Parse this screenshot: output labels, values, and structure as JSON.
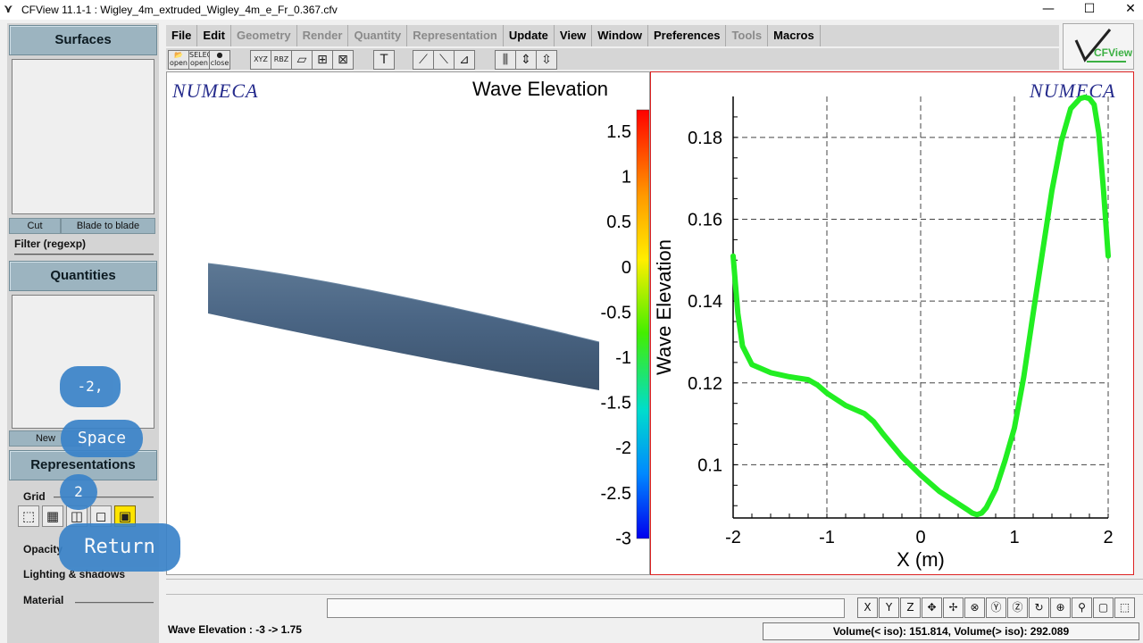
{
  "window": {
    "title": "CFView 11.1-1 : Wigley_4m_extruded_Wigley_4m_e_Fr_0.367.cfv",
    "icon": "cfview-app-icon",
    "controls": {
      "minimize": "—",
      "maximize": "☐",
      "close": "✕"
    }
  },
  "left_panel": {
    "surfaces": {
      "header": "Surfaces",
      "cut_label": "Cut",
      "blade_label": "Blade to blade",
      "filter_label": "Filter (regexp)"
    },
    "quantities": {
      "header": "Quantities",
      "new_label": "New"
    },
    "representations": {
      "header": "Representations",
      "grid_label": "Grid",
      "grid_icons": [
        "cube-icon",
        "grid-cube-icon",
        "solid-cube-icon",
        "edge-cube-icon",
        "selected-cube-icon"
      ],
      "opacity_label": "Opacity",
      "lighting_label": "Lighting & shadows",
      "material_label": "Material"
    }
  },
  "menubar": {
    "items": [
      {
        "label": "File",
        "enabled": true
      },
      {
        "label": "Edit",
        "enabled": true
      },
      {
        "label": "Geometry",
        "enabled": false
      },
      {
        "label": "Render",
        "enabled": false
      },
      {
        "label": "Quantity",
        "enabled": false
      },
      {
        "label": "Representation",
        "enabled": false
      },
      {
        "label": "Update",
        "enabled": true
      },
      {
        "label": "View",
        "enabled": true
      },
      {
        "label": "Window",
        "enabled": true
      },
      {
        "label": "Preferences",
        "enabled": true
      },
      {
        "label": "Tools",
        "enabled": false
      },
      {
        "label": "Macros",
        "enabled": true
      }
    ],
    "logo_text": "CFView"
  },
  "toolbar": {
    "open": "open",
    "select_open": "SELECT open",
    "close": "close",
    "xyz": "XYZ",
    "rbz": "RBZ"
  },
  "left_view": {
    "brand": "NUMECA",
    "title": "Wave Elevation",
    "colorbar_ticks": [
      "1.5",
      "1",
      "0.5",
      "0",
      "-0.5",
      "-1",
      "-1.5",
      "-2",
      "-2.5",
      "-3"
    ]
  },
  "right_view": {
    "brand": "NUMECA"
  },
  "chart_data": {
    "type": "line",
    "xlabel": "X (m)",
    "ylabel": "Wave Elevation",
    "xlim": [
      -2,
      2
    ],
    "ylim": [
      0.087,
      0.19
    ],
    "x_ticks": [
      "-2",
      "-1",
      "0",
      "1",
      "2"
    ],
    "y_ticks": [
      "0.1",
      "0.12",
      "0.14",
      "0.16",
      "0.18"
    ],
    "grid": true,
    "series": [
      {
        "color": "#22ee22",
        "x": [
          -2.0,
          -1.95,
          -1.9,
          -1.8,
          -1.6,
          -1.4,
          -1.2,
          -1.1,
          -1.0,
          -0.8,
          -0.6,
          -0.5,
          -0.4,
          -0.2,
          0.0,
          0.2,
          0.4,
          0.5,
          0.55,
          0.6,
          0.65,
          0.7,
          0.8,
          0.9,
          1.0,
          1.1,
          1.2,
          1.3,
          1.4,
          1.5,
          1.6,
          1.7,
          1.75,
          1.8,
          1.85,
          1.9,
          1.95,
          2.0
        ],
        "y": [
          0.151,
          0.137,
          0.129,
          0.1245,
          0.1225,
          0.1215,
          0.1208,
          0.1195,
          0.1175,
          0.1145,
          0.1125,
          0.1105,
          0.1075,
          0.102,
          0.0975,
          0.0935,
          0.0905,
          0.089,
          0.0882,
          0.0878,
          0.0882,
          0.0895,
          0.094,
          0.101,
          0.109,
          0.1215,
          0.137,
          0.152,
          0.167,
          0.179,
          0.187,
          0.1895,
          0.1898,
          0.1895,
          0.188,
          0.181,
          0.167,
          0.151
        ]
      }
    ]
  },
  "bottom": {
    "nav_buttons": [
      "X",
      "Y",
      "Z",
      "move-icon",
      "pan-icon",
      "rotate-x-icon",
      "rotate-y-icon",
      "rotate-z-icon",
      "rotate-icon",
      "zoom-in-icon",
      "zoom-icon",
      "fit-icon",
      "cube-view-icon"
    ],
    "status_left": "Wave Elevation :  -3  ->  1.75",
    "status_right": "Volume(< iso): 151.814, Volume(> iso): 292.089"
  },
  "key_overlays": [
    "-2,",
    "Space",
    "2",
    "Return"
  ]
}
